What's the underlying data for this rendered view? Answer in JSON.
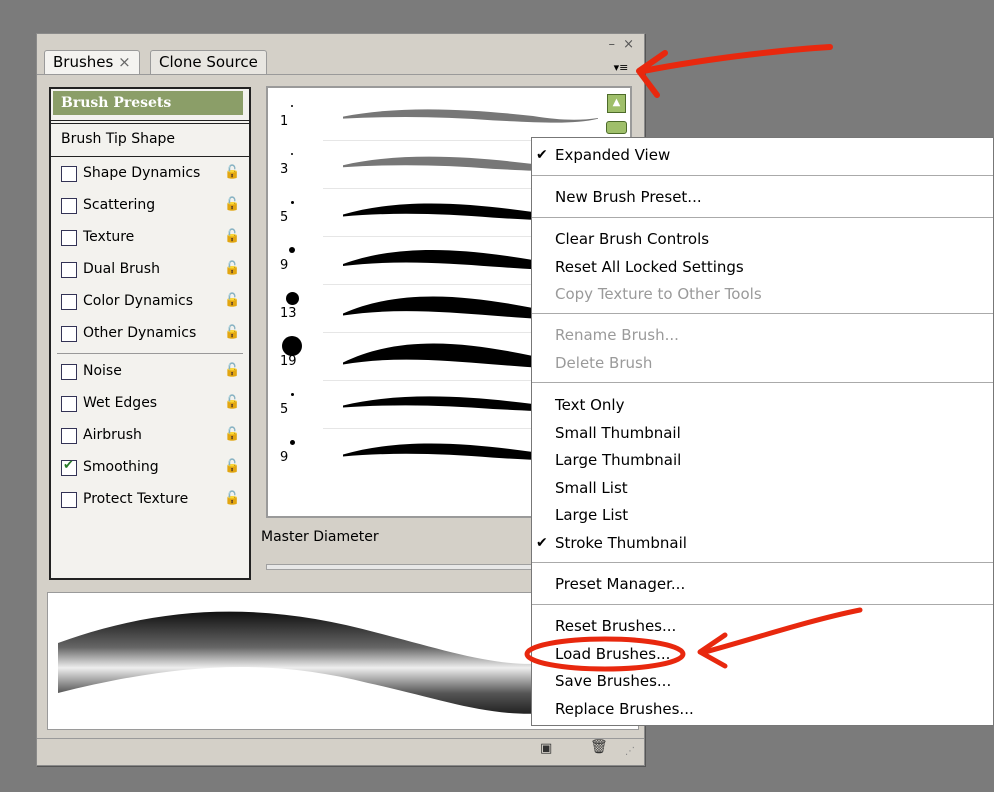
{
  "panel": {
    "tabs": [
      {
        "label": "Brushes",
        "close": "×"
      },
      {
        "label": "Clone Source"
      }
    ],
    "window_controls": "– ×",
    "menu_button": "▾≡"
  },
  "left_list": {
    "header": "Brush Presets",
    "tip_shape": "Brush Tip Shape",
    "options": [
      {
        "label": "Shape Dynamics",
        "checked": false
      },
      {
        "label": "Scattering",
        "checked": false
      },
      {
        "label": "Texture",
        "checked": false
      },
      {
        "label": "Dual Brush",
        "checked": false
      },
      {
        "label": "Color Dynamics",
        "checked": false
      },
      {
        "label": "Other Dynamics",
        "checked": false
      },
      {
        "label": "Noise",
        "checked": false
      },
      {
        "label": "Wet Edges",
        "checked": false
      },
      {
        "label": "Airbrush",
        "checked": false
      },
      {
        "label": "Smoothing",
        "checked": true
      },
      {
        "label": "Protect Texture",
        "checked": false
      }
    ]
  },
  "brushes": [
    {
      "size": "1"
    },
    {
      "size": "3"
    },
    {
      "size": "5"
    },
    {
      "size": "9"
    },
    {
      "size": "13"
    },
    {
      "size": "19"
    },
    {
      "size": "5"
    },
    {
      "size": "9"
    }
  ],
  "master_diameter_label": "Master Diameter",
  "menu": {
    "items": [
      {
        "label": "Expanded View",
        "checked": true,
        "disabled": false
      },
      {
        "label": "New Brush Preset...",
        "checked": false,
        "disabled": false
      },
      {
        "label": "Clear Brush Controls",
        "checked": false,
        "disabled": false
      },
      {
        "label": "Reset All Locked Settings",
        "checked": false,
        "disabled": false
      },
      {
        "label": "Copy Texture to Other Tools",
        "checked": false,
        "disabled": true
      },
      {
        "label": "Rename Brush...",
        "checked": false,
        "disabled": true
      },
      {
        "label": "Delete Brush",
        "checked": false,
        "disabled": true
      },
      {
        "label": "Text Only",
        "checked": false,
        "disabled": false
      },
      {
        "label": "Small Thumbnail",
        "checked": false,
        "disabled": false
      },
      {
        "label": "Large Thumbnail",
        "checked": false,
        "disabled": false
      },
      {
        "label": "Small List",
        "checked": false,
        "disabled": false
      },
      {
        "label": "Large List",
        "checked": false,
        "disabled": false
      },
      {
        "label": "Stroke Thumbnail",
        "checked": true,
        "disabled": false
      },
      {
        "label": "Preset Manager...",
        "checked": false,
        "disabled": false
      },
      {
        "label": "Reset Brushes...",
        "checked": false,
        "disabled": false
      },
      {
        "label": "Load Brushes...",
        "checked": false,
        "disabled": false
      },
      {
        "label": "Save Brushes...",
        "checked": false,
        "disabled": false
      },
      {
        "label": "Replace Brushes...",
        "checked": false,
        "disabled": false
      }
    ],
    "check_glyph": "✔"
  },
  "colors": {
    "desktop_bg": "#7b7b7b",
    "panel_bg": "#d4d0c8",
    "header_bg": "#8b9e68",
    "annotation_red": "#e8280e"
  }
}
